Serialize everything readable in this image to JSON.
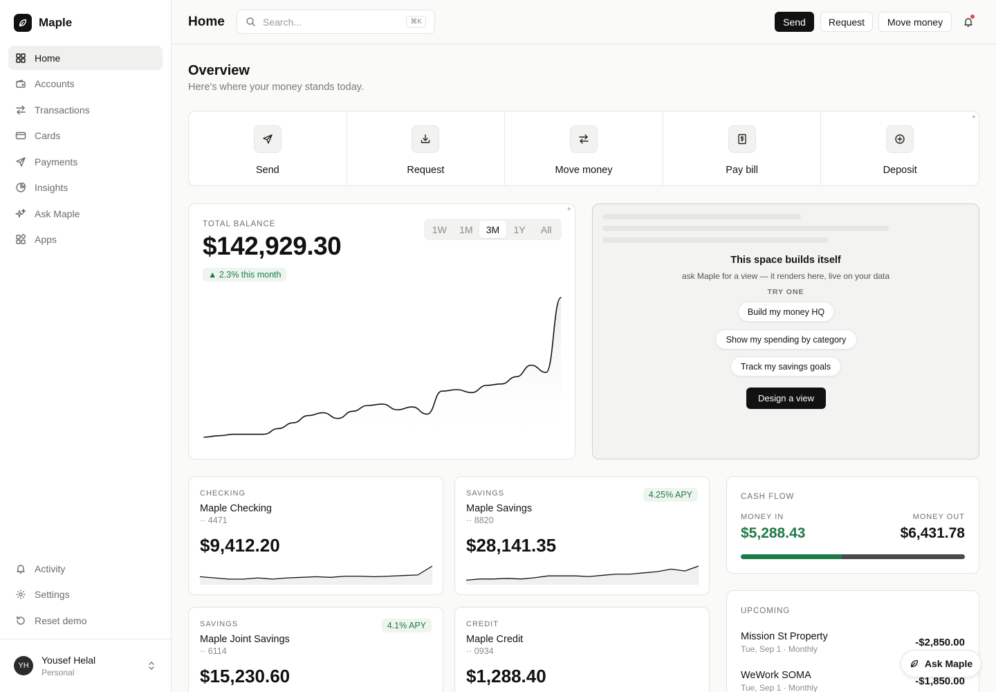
{
  "app": {
    "name": "Maple"
  },
  "sidebar": {
    "items": [
      {
        "label": "Home",
        "icon": "grid-icon"
      },
      {
        "label": "Accounts",
        "icon": "wallet-icon"
      },
      {
        "label": "Transactions",
        "icon": "arrows-icon"
      },
      {
        "label": "Cards",
        "icon": "card-icon"
      },
      {
        "label": "Payments",
        "icon": "send-icon"
      },
      {
        "label": "Insights",
        "icon": "pie-icon"
      },
      {
        "label": "Ask Maple",
        "icon": "sparkles-icon"
      },
      {
        "label": "Apps",
        "icon": "apps-icon"
      }
    ],
    "bottom": [
      {
        "label": "Activity",
        "icon": "bell-icon"
      },
      {
        "label": "Settings",
        "icon": "gear-icon"
      },
      {
        "label": "Reset demo",
        "icon": "reset-icon"
      }
    ],
    "user": {
      "initials": "YH",
      "name": "Yousef Helal",
      "plan": "Personal"
    }
  },
  "header": {
    "title": "Home",
    "search_placeholder": "Search...",
    "search_shortcut": "⌘K",
    "send": "Send",
    "request": "Request",
    "move_money": "Move money"
  },
  "overview": {
    "title": "Overview",
    "subtitle": "Here's where your money stands today."
  },
  "quick_actions": [
    {
      "label": "Send",
      "icon": "send-icon"
    },
    {
      "label": "Request",
      "icon": "download-icon"
    },
    {
      "label": "Move money",
      "icon": "transfer-icon"
    },
    {
      "label": "Pay bill",
      "icon": "bill-icon"
    },
    {
      "label": "Deposit",
      "icon": "plus-circle-icon"
    }
  ],
  "balance": {
    "label": "TOTAL BALANCE",
    "amount": "$142,929.30",
    "delta": "▲ 2.3% this month",
    "ranges": [
      "1W",
      "1M",
      "3M",
      "1Y",
      "All"
    ],
    "active_range": "3M"
  },
  "chart_data": {
    "type": "line",
    "title": "",
    "xlabel": "",
    "ylabel": "",
    "ylim": [
      0,
      100
    ],
    "y": [
      3,
      4,
      5,
      5,
      5,
      9,
      13,
      18,
      20,
      16,
      21,
      25,
      26,
      22,
      24,
      19,
      35,
      36,
      34,
      39,
      40,
      45,
      53,
      48,
      100
    ]
  },
  "builder": {
    "title": "This space builds itself",
    "subtitle": "ask Maple for a view — it renders here, live on your data",
    "try_label": "TRY ONE",
    "suggestions": [
      "Build my money HQ",
      "Show my spending by category",
      "Track my savings goals"
    ],
    "cta": "Design a view"
  },
  "accounts": [
    {
      "type": "CHECKING",
      "name": "Maple Checking",
      "mask": "·· 4471",
      "balance": "$9,412.20",
      "apy": "",
      "trend": [
        10,
        8,
        6,
        6,
        8,
        6,
        8,
        9,
        10,
        9,
        11,
        11,
        10,
        11,
        12,
        13,
        28
      ]
    },
    {
      "type": "SAVINGS",
      "name": "Maple Savings",
      "mask": "·· 8820",
      "balance": "$28,141.35",
      "apy": "4.25% APY",
      "trend": [
        4,
        6,
        6,
        7,
        6,
        8,
        11,
        11,
        11,
        10,
        12,
        14,
        14,
        16,
        18,
        22,
        19,
        27
      ]
    },
    {
      "type": "SAVINGS",
      "name": "Maple Joint Savings",
      "mask": "·· 6114",
      "balance": "$15,230.60",
      "apy": "4.1% APY",
      "trend": []
    },
    {
      "type": "CREDIT",
      "name": "Maple Credit",
      "mask": "·· 0934",
      "balance": "$1,288.40",
      "apy": "",
      "trend": []
    }
  ],
  "cashflow": {
    "label": "CASH FLOW",
    "in_label": "MONEY IN",
    "in_amount": "$5,288.43",
    "out_label": "MONEY OUT",
    "out_amount": "$6,431.78",
    "in_share": 0.45,
    "in_color": "#1e7a46",
    "out_color": "#4a4a4a"
  },
  "upcoming": {
    "label": "UPCOMING",
    "items": [
      {
        "name": "Mission St Property",
        "meta": "Tue, Sep 1 · Monthly",
        "amount": "-$2,850.00"
      },
      {
        "name": "WeWork SOMA",
        "meta": "Tue, Sep 1 · Monthly",
        "amount": "-$1,850.00"
      }
    ]
  },
  "ask_fab": "Ask Maple"
}
